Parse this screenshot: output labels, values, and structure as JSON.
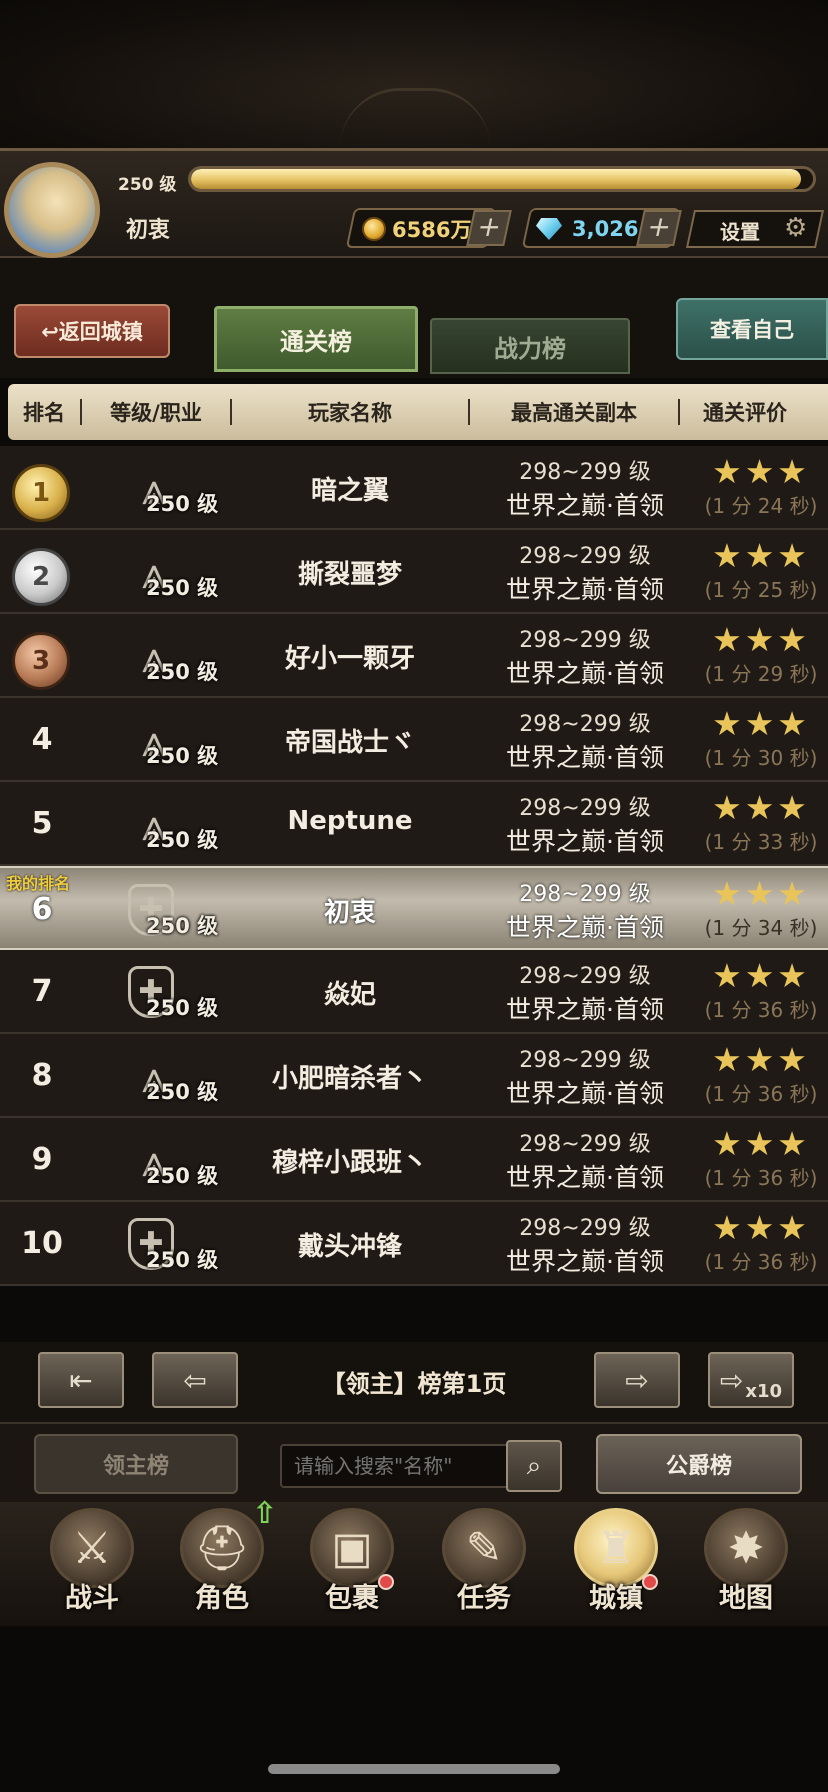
{
  "header": {
    "level_label": "250 级",
    "xp_fraction": 0.98,
    "player_name": "初衷",
    "gold": "6586万",
    "gems": "3,026",
    "settings_label": "设置",
    "plus_symbol": "+"
  },
  "nav": {
    "back_label": "↩返回城镇",
    "tabs": [
      {
        "label": "通关榜",
        "active": true
      },
      {
        "label": "战力榜",
        "active": false
      }
    ],
    "view_self_label": "查看自己"
  },
  "table": {
    "columns": [
      "排名",
      "等级/职业",
      "玩家名称",
      "最高通关副本",
      "通关评价"
    ],
    "my_rank_tag": "我的排名",
    "rows": [
      {
        "rank": "1",
        "medal": "gold",
        "class_icon": "warrior-icon",
        "level": "250 级",
        "name": "暗之翼",
        "dungeon_range": "298~299 级",
        "dungeon_name": "世界之巅·首领",
        "stars": "★★★",
        "time": "(1 分 24 秒)"
      },
      {
        "rank": "2",
        "medal": "silver",
        "class_icon": "warrior-icon",
        "level": "250 级",
        "name": "撕裂噩梦",
        "dungeon_range": "298~299 级",
        "dungeon_name": "世界之巅·首领",
        "stars": "★★★",
        "time": "(1 分 25 秒)"
      },
      {
        "rank": "3",
        "medal": "bronze",
        "class_icon": "warrior-icon",
        "level": "250 级",
        "name": "好小一颗牙",
        "dungeon_range": "298~299 级",
        "dungeon_name": "世界之巅·首领",
        "stars": "★★★",
        "time": "(1 分 29 秒)"
      },
      {
        "rank": "4",
        "medal": "",
        "class_icon": "warrior-icon",
        "level": "250 级",
        "name": "帝国战士ヾ",
        "dungeon_range": "298~299 级",
        "dungeon_name": "世界之巅·首领",
        "stars": "★★★",
        "time": "(1 分 30 秒)"
      },
      {
        "rank": "5",
        "medal": "",
        "class_icon": "warrior-icon",
        "level": "250 级",
        "name": "Neptune",
        "dungeon_range": "298~299 级",
        "dungeon_name": "世界之巅·首领",
        "stars": "★★★",
        "time": "(1 分 33 秒)"
      },
      {
        "rank": "6",
        "medal": "",
        "class_icon": "shield-icon",
        "level": "250 级",
        "name": "初衷",
        "dungeon_range": "298~299 级",
        "dungeon_name": "世界之巅·首领",
        "stars": "★★★",
        "time": "(1 分 34 秒)",
        "mine": true
      },
      {
        "rank": "7",
        "medal": "",
        "class_icon": "shield-icon",
        "level": "250 级",
        "name": "焱妃",
        "dungeon_range": "298~299 级",
        "dungeon_name": "世界之巅·首领",
        "stars": "★★★",
        "time": "(1 分 36 秒)"
      },
      {
        "rank": "8",
        "medal": "",
        "class_icon": "warrior-icon",
        "level": "250 级",
        "name": "小肥暗杀者丶",
        "dungeon_range": "298~299 级",
        "dungeon_name": "世界之巅·首领",
        "stars": "★★★",
        "time": "(1 分 36 秒)"
      },
      {
        "rank": "9",
        "medal": "",
        "class_icon": "warrior-icon",
        "level": "250 级",
        "name": "穆梓小跟班丶",
        "dungeon_range": "298~299 级",
        "dungeon_name": "世界之巅·首领",
        "stars": "★★★",
        "time": "(1 分 36 秒)"
      },
      {
        "rank": "10",
        "medal": "",
        "class_icon": "shield-icon",
        "level": "250 级",
        "name": "戴头冲锋",
        "dungeon_range": "298~299 级",
        "dungeon_name": "世界之巅·首领",
        "stars": "★★★",
        "time": "(1 分 36 秒)"
      }
    ]
  },
  "pager": {
    "label": "【领主】榜第1页",
    "x10": "x10"
  },
  "controls": {
    "left_button": "领主榜",
    "search_placeholder": "请输入搜索\"名称\"",
    "right_button": "公爵榜"
  },
  "bottom_nav": [
    {
      "label": "战斗",
      "icon": "swords-icon",
      "badge": false
    },
    {
      "label": "角色",
      "icon": "helmet-icon",
      "badge": false,
      "upgrade": true
    },
    {
      "label": "包裹",
      "icon": "backpack-icon",
      "badge": true
    },
    {
      "label": "任务",
      "icon": "scroll-icon",
      "badge": false
    },
    {
      "label": "城镇",
      "icon": "tower-icon",
      "badge": true,
      "active": true
    },
    {
      "label": "地图",
      "icon": "map-icon",
      "badge": false
    }
  ]
}
